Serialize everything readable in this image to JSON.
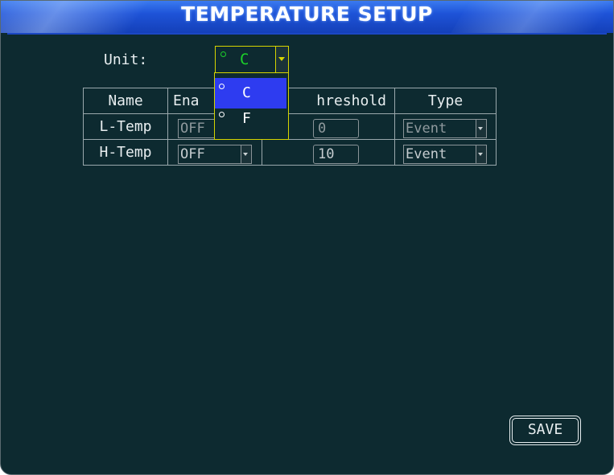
{
  "title": "TEMPERATURE SETUP",
  "unit": {
    "label": "Unit:",
    "value": "C",
    "options": [
      "C",
      "F"
    ],
    "selected_option": "C"
  },
  "table": {
    "headers": [
      "Name",
      "Ena",
      "hreshold",
      "Type"
    ],
    "rows": [
      {
        "name": "L-Temp",
        "enable": "OFF",
        "threshold": "0",
        "type": "Event"
      },
      {
        "name": "H-Temp",
        "enable": "OFF",
        "threshold": "10",
        "type": "Event"
      }
    ]
  },
  "save_label": "SAVE",
  "colors": {
    "background": "#0d2a30",
    "title_bar": "#1e53d8",
    "focus_border": "#d6d400",
    "selected_value": "#1cd02a",
    "dropdown_highlight": "#2e3cf0"
  }
}
